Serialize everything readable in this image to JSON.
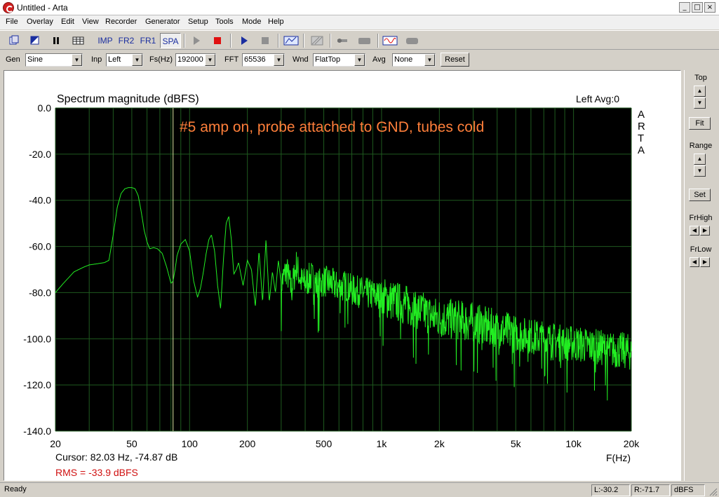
{
  "window": {
    "title": "Untitled - Arta",
    "min_glyph": "_",
    "max_glyph": "□",
    "close_glyph": "×"
  },
  "menu": [
    "File",
    "Overlay",
    "Edit",
    "View",
    "Recorder",
    "Generator",
    "Setup",
    "Tools",
    "Mode",
    "Help"
  ],
  "toolbar": {
    "imp": "IMP",
    "fr2": "FR2",
    "fr1": "FR1",
    "spa": "SPA"
  },
  "controls": {
    "gen_label": "Gen",
    "gen_value": "Sine",
    "inp_label": "Inp",
    "inp_value": "Left",
    "fs_label": "Fs(Hz)",
    "fs_value": "192000",
    "fft_label": "FFT",
    "fft_value": "65536",
    "wnd_label": "Wnd",
    "wnd_value": "FlatTop",
    "avg_label": "Avg",
    "avg_value": "None",
    "reset_label": "Reset"
  },
  "right_panel": {
    "top_label": "Top",
    "fit_label": "Fit",
    "range_label": "Range",
    "set_label": "Set",
    "frhigh_label": "FrHigh",
    "frlow_label": "FrLow"
  },
  "status": {
    "ready": "Ready",
    "left": "L:-30.2",
    "right": "R:-71.7",
    "unit": "dBFS"
  },
  "colors": {
    "plot_bg": "#000000",
    "grid": "#1f5a1f",
    "trace": "#22ee22",
    "annotation": "#ff7f3a",
    "rms": "#d01010",
    "cursor": "#d8e8a0"
  },
  "chart_data": {
    "type": "line",
    "title": "Spectrum magnitude (dBFS)",
    "channel_info": "Left  Avg:0",
    "annotation": "#5 amp on, probe attached to GND, tubes cold",
    "watermark": [
      "A",
      "R",
      "T",
      "A"
    ],
    "xlabel": "F(Hz)",
    "xscale": "log",
    "xlim": [
      20,
      20000
    ],
    "ylim": [
      -140,
      0
    ],
    "x_ticks": [
      {
        "v": 20,
        "label": "20"
      },
      {
        "v": 50,
        "label": "50"
      },
      {
        "v": 100,
        "label": "100"
      },
      {
        "v": 200,
        "label": "200"
      },
      {
        "v": 500,
        "label": "500"
      },
      {
        "v": 1000,
        "label": "1k"
      },
      {
        "v": 2000,
        "label": "2k"
      },
      {
        "v": 5000,
        "label": "5k"
      },
      {
        "v": 10000,
        "label": "10k"
      },
      {
        "v": 20000,
        "label": "20k"
      }
    ],
    "y_ticks": [
      {
        "v": 0,
        "label": "0.0"
      },
      {
        "v": -20,
        "label": "-20.0"
      },
      {
        "v": -40,
        "label": "-40.0"
      },
      {
        "v": -60,
        "label": "-60.0"
      },
      {
        "v": -80,
        "label": "-80.0"
      },
      {
        "v": -100,
        "label": "-100.0"
      },
      {
        "v": -120,
        "label": "-120.0"
      },
      {
        "v": -140,
        "label": "-140.0"
      }
    ],
    "grid": true,
    "cursor_x": 82.03,
    "cursor_text": "Cursor: 82.03 Hz, -74.87 dB",
    "rms_text": "RMS =  -33.9 dBFS",
    "series": [
      {
        "x": [
          20,
          22,
          25,
          28,
          30,
          33,
          36,
          38,
          40,
          42,
          44,
          46,
          48,
          50,
          52,
          54,
          56,
          58,
          60,
          62,
          65,
          68,
          72,
          76,
          80,
          82,
          84,
          86,
          90,
          95,
          100,
          105,
          110,
          114,
          118,
          122,
          126,
          130,
          135,
          140,
          145,
          150,
          155,
          160,
          165,
          170,
          175,
          180,
          190,
          200,
          210,
          220,
          230,
          240,
          250,
          260,
          270,
          280,
          290,
          300,
          320,
          340,
          360,
          380,
          400,
          430,
          460,
          500,
          550,
          600,
          650,
          700,
          800,
          900,
          1000,
          1200,
          1400,
          1600,
          1800,
          2000,
          2500,
          3000,
          3500,
          4000,
          5000,
          6000,
          7000,
          8000,
          9000,
          10000,
          12000,
          14000,
          16000,
          18000,
          20000
        ],
        "values": [
          -80,
          -76,
          -71,
          -69,
          -68,
          -67.5,
          -67,
          -66,
          -55,
          -43,
          -37,
          -35,
          -34.5,
          -34.5,
          -35,
          -38,
          -45,
          -53,
          -58,
          -61,
          -60.5,
          -61,
          -63,
          -69,
          -76,
          -75,
          -70,
          -64,
          -59,
          -57,
          -62,
          -75,
          -82,
          -78,
          -71,
          -63,
          -57,
          -55,
          -62,
          -77,
          -87,
          -66,
          -50,
          -47,
          -57,
          -72,
          -70,
          -67,
          -77,
          -66,
          -70,
          -86,
          -62,
          -84,
          -57,
          -84,
          -71,
          -80,
          -66,
          -76,
          -70,
          -79,
          -68,
          -75,
          -76,
          -73,
          -77,
          -75,
          -76,
          -78,
          -77,
          -79,
          -80,
          -81,
          -82,
          -84,
          -86,
          -88,
          -90,
          -91,
          -92,
          -93,
          -95,
          -96,
          -98,
          -99,
          -100,
          -101,
          -102,
          -102,
          -103,
          -104,
          -105,
          -105,
          -106
        ]
      }
    ]
  }
}
